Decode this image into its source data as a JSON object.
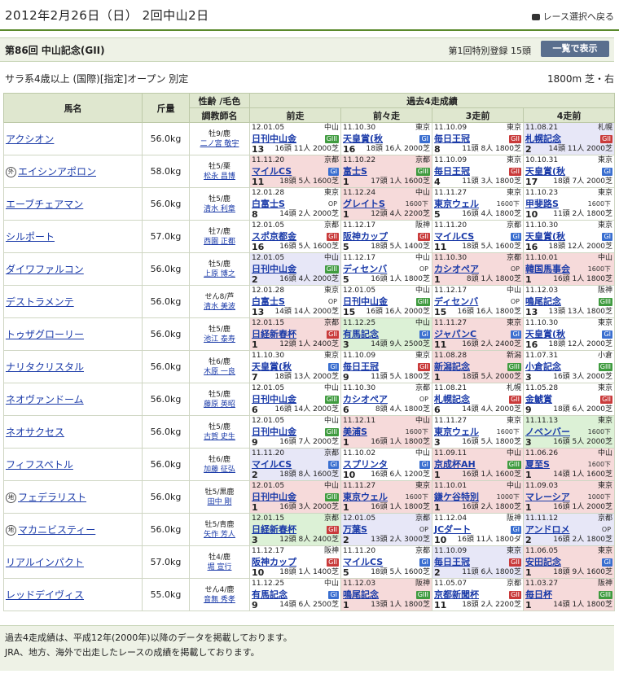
{
  "header": {
    "date": "2012年2月26日（日） 2回中山2日",
    "back_label": "レース選択へ戻る"
  },
  "race": {
    "name": "第86回 中山記念(GII)",
    "registration": "第1回特別登録 15頭",
    "list_button": "一覧で表示",
    "conditions": "サラ系4歳以上 (国際)[指定]オープン 別定",
    "distance": "1800m 芝・右"
  },
  "table_headers": {
    "horse": "馬名",
    "weight": "斤量",
    "sexage_color": "性齢 /毛色",
    "jockey": "調教師名",
    "past4": "過去4走成績",
    "p1": "前走",
    "p2": "前々走",
    "p3": "3走前",
    "p4": "4走前"
  },
  "horses": [
    {
      "name": "アクシオン",
      "tag": "",
      "weight": "56.0kg",
      "sexage": "牡9/鹿",
      "trainer": "二ノ宮 敬宇",
      "races": [
        {
          "date": "12.01.05",
          "venue": "中山",
          "race": "日刊中山金",
          "grade": "GIII",
          "num": "13",
          "pop": "16頭 11人 2000芝",
          "place": "13",
          "bg": ""
        },
        {
          "date": "11.10.30",
          "venue": "東京",
          "race": "天皇賞(秋",
          "grade": "GI",
          "num": "16",
          "pop": "18頭 16人 2000芝",
          "place": "16",
          "bg": ""
        },
        {
          "date": "11.10.09",
          "venue": "東京",
          "race": "毎日王冠",
          "grade": "GII",
          "num": "8",
          "pop": "11頭 8人 1800芝",
          "place": "8",
          "bg": ""
        },
        {
          "date": "11.08.21",
          "venue": "札幌",
          "race": "札幌記念",
          "grade": "GII",
          "num": "2",
          "pop": "14頭 11人 2000芝",
          "place": "2",
          "bg": "bg1"
        }
      ]
    },
    {
      "name": "エイシンアポロン",
      "tag": "外",
      "weight": "58.0kg",
      "sexage": "牡5/栗",
      "trainer": "松永 昌博",
      "races": [
        {
          "date": "11.11.20",
          "venue": "京都",
          "race": "マイルCS",
          "grade": "GI",
          "num": "11",
          "pop": "18頭 5人 1600芝",
          "place": "11",
          "bg": "bg2"
        },
        {
          "date": "11.10.22",
          "venue": "京都",
          "race": "富士S",
          "grade": "GIII",
          "num": "1",
          "pop": "17頭 1人 1600芝",
          "place": "1",
          "bg": "bg2"
        },
        {
          "date": "11.10.09",
          "venue": "東京",
          "race": "毎日王冠",
          "grade": "GII",
          "num": "4",
          "pop": "11頭 3人 1800芝",
          "place": "4",
          "bg": ""
        },
        {
          "date": "10.10.31",
          "venue": "東京",
          "race": "天皇賞(秋",
          "grade": "GI",
          "num": "17",
          "pop": "18頭 7人 2000芝",
          "place": "17",
          "bg": ""
        }
      ]
    },
    {
      "name": "エーブチェアマン",
      "tag": "",
      "weight": "56.0kg",
      "sexage": "牡5/鹿",
      "trainer": "清水 利章",
      "races": [
        {
          "date": "12.01.28",
          "venue": "東京",
          "race": "白富士S",
          "grade": "OP",
          "num": "8",
          "pop": "14頭 2人 2000芝",
          "place": "8",
          "bg": ""
        },
        {
          "date": "11.12.24",
          "venue": "中山",
          "race": "グレイトS",
          "grade": "1600下",
          "num": "1",
          "pop": "12頭 4人 2200芝",
          "place": "1",
          "bg": "bg2"
        },
        {
          "date": "11.11.27",
          "venue": "東京",
          "race": "東京ウェル",
          "grade": "1600下",
          "num": "5",
          "pop": "16頭 4人 1800芝",
          "place": "5",
          "bg": ""
        },
        {
          "date": "11.10.23",
          "venue": "東京",
          "race": "甲斐路S",
          "grade": "1600下",
          "num": "10",
          "pop": "11頭 2人 1800芝",
          "place": "10",
          "bg": ""
        }
      ]
    },
    {
      "name": "シルポート",
      "tag": "",
      "weight": "57.0kg",
      "sexage": "牡7/鹿",
      "trainer": "西園 正都",
      "races": [
        {
          "date": "12.01.05",
          "venue": "京都",
          "race": "スポ京都金",
          "grade": "GII",
          "num": "16",
          "pop": "16頭 5人 1600芝",
          "place": "16",
          "bg": ""
        },
        {
          "date": "11.12.17",
          "venue": "阪神",
          "race": "阪神カップ",
          "grade": "GII",
          "num": "5",
          "pop": "18頭 5人 1400芝",
          "place": "5",
          "bg": ""
        },
        {
          "date": "11.11.20",
          "venue": "京都",
          "race": "マイルCS",
          "grade": "GI",
          "num": "11",
          "pop": "18頭 5人 1600芝",
          "place": "11",
          "bg": ""
        },
        {
          "date": "11.10.30",
          "venue": "東京",
          "race": "天皇賞(秋",
          "grade": "GI",
          "num": "16",
          "pop": "18頭 12人 2000芝",
          "place": "16",
          "bg": ""
        }
      ]
    },
    {
      "name": "ダイワファルコン",
      "tag": "",
      "weight": "56.0kg",
      "sexage": "牡5/鹿",
      "trainer": "上原 博之",
      "races": [
        {
          "date": "12.01.05",
          "venue": "中山",
          "race": "日刊中山金",
          "grade": "GIII",
          "num": "2",
          "pop": "16頭 4人 2000芝",
          "place": "2",
          "bg": "bg1"
        },
        {
          "date": "11.12.17",
          "venue": "中山",
          "race": "ディセンバ",
          "grade": "OP",
          "num": "5",
          "pop": "16頭 1人 1800芝",
          "place": "5",
          "bg": ""
        },
        {
          "date": "11.10.30",
          "venue": "京都",
          "race": "カシオペア",
          "grade": "OP",
          "num": "1",
          "pop": "8頭 1人 1800芝",
          "place": "1",
          "bg": "bg2"
        },
        {
          "date": "11.10.01",
          "venue": "中山",
          "race": "韓国馬事会",
          "grade": "1600下",
          "num": "1",
          "pop": "16頭 1人 1800芝",
          "place": "1",
          "bg": "bg2"
        }
      ]
    },
    {
      "name": "デストラメンテ",
      "tag": "",
      "weight": "56.0kg",
      "sexage": "せん8/芦",
      "trainer": "清水 美波",
      "races": [
        {
          "date": "12.01.28",
          "venue": "東京",
          "race": "白富士S",
          "grade": "OP",
          "num": "13",
          "pop": "14頭 14人 2000芝",
          "place": "13",
          "bg": ""
        },
        {
          "date": "12.01.05",
          "venue": "中山",
          "race": "日刊中山金",
          "grade": "GIII",
          "num": "15",
          "pop": "16頭 16人 2000芝",
          "place": "15",
          "bg": ""
        },
        {
          "date": "11.12.17",
          "venue": "中山",
          "race": "ディセンバ",
          "grade": "OP",
          "num": "15",
          "pop": "16頭 16人 1800芝",
          "place": "15",
          "bg": ""
        },
        {
          "date": "11.12.03",
          "venue": "阪神",
          "race": "鳴尾記念",
          "grade": "GIII",
          "num": "13",
          "pop": "13頭 13人 1800芝",
          "place": "13",
          "bg": ""
        }
      ]
    },
    {
      "name": "トゥザグローリー",
      "tag": "",
      "weight": "56.0kg",
      "sexage": "牡5/鹿",
      "trainer": "池江 泰寿",
      "races": [
        {
          "date": "12.01.15",
          "venue": "京都",
          "race": "日経新春杯",
          "grade": "GII",
          "num": "1",
          "pop": "12頭 1人 2400芝",
          "place": "1",
          "bg": "bg2"
        },
        {
          "date": "11.12.25",
          "venue": "中山",
          "race": "有馬記念",
          "grade": "GI",
          "num": "3",
          "pop": "14頭 9人 2500芝",
          "place": "3",
          "bg": "bg3"
        },
        {
          "date": "11.11.27",
          "venue": "東京",
          "race": "ジャパンC",
          "grade": "GI",
          "num": "11",
          "pop": "16頭 2人 2400芝",
          "place": "11",
          "bg": "bg2"
        },
        {
          "date": "11.10.30",
          "venue": "東京",
          "race": "天皇賞(秋",
          "grade": "GI",
          "num": "16",
          "pop": "18頭 12人 2000芝",
          "place": "16",
          "bg": ""
        }
      ]
    },
    {
      "name": "ナリタクリスタル",
      "tag": "",
      "weight": "56.0kg",
      "sexage": "牡6/鹿",
      "trainer": "木原 一良",
      "races": [
        {
          "date": "11.10.30",
          "venue": "東京",
          "race": "天皇賞(秋",
          "grade": "GI",
          "num": "7",
          "pop": "18頭 13人 2000芝",
          "place": "7",
          "bg": ""
        },
        {
          "date": "11.10.09",
          "venue": "東京",
          "race": "毎日王冠",
          "grade": "GII",
          "num": "9",
          "pop": "11頭 5人 1800芝",
          "place": "9",
          "bg": ""
        },
        {
          "date": "11.08.28",
          "venue": "新潟",
          "race": "新潟記念",
          "grade": "GIII",
          "num": "1",
          "pop": "18頭 5人 2000芝",
          "place": "1",
          "bg": "bg2"
        },
        {
          "date": "11.07.31",
          "venue": "小倉",
          "race": "小倉記念",
          "grade": "GIII",
          "num": "3",
          "pop": "16頭 3人 2000芝",
          "place": "3",
          "bg": ""
        }
      ]
    },
    {
      "name": "ネオヴァンドーム",
      "tag": "",
      "weight": "56.0kg",
      "sexage": "牡5/鹿",
      "trainer": "藤原 英昭",
      "races": [
        {
          "date": "12.01.05",
          "venue": "中山",
          "race": "日刊中山金",
          "grade": "GIII",
          "num": "6",
          "pop": "16頭 14人 2000芝",
          "place": "6",
          "bg": ""
        },
        {
          "date": "11.10.30",
          "venue": "京都",
          "race": "カシオペア",
          "grade": "OP",
          "num": "6",
          "pop": "8頭 4人 1800芝",
          "place": "6",
          "bg": ""
        },
        {
          "date": "11.08.21",
          "venue": "札幌",
          "race": "札幌記念",
          "grade": "GII",
          "num": "6",
          "pop": "14頭 4人 2000芝",
          "place": "6",
          "bg": ""
        },
        {
          "date": "11.05.28",
          "venue": "東京",
          "race": "金鯱賞",
          "grade": "GII",
          "num": "9",
          "pop": "18頭 6人 2000芝",
          "place": "9",
          "bg": ""
        }
      ]
    },
    {
      "name": "ネオサクセス",
      "tag": "",
      "weight": "56.0kg",
      "sexage": "牡5/鹿",
      "trainer": "古賀 史生",
      "races": [
        {
          "date": "12.01.05",
          "venue": "中山",
          "race": "日刊中山金",
          "grade": "GIII",
          "num": "9",
          "pop": "16頭 7人 2000芝",
          "place": "9",
          "bg": ""
        },
        {
          "date": "11.12.11",
          "venue": "中山",
          "race": "美浦S",
          "grade": "1600下",
          "num": "1",
          "pop": "16頭 1人 1800芝",
          "place": "1",
          "bg": "bg2"
        },
        {
          "date": "11.11.27",
          "venue": "東京",
          "race": "東京ウェル",
          "grade": "1600下",
          "num": "3",
          "pop": "16頭 5人 1800芝",
          "place": "3",
          "bg": ""
        },
        {
          "date": "11.11.13",
          "venue": "東京",
          "race": "ノベンバー",
          "grade": "1600下",
          "num": "3",
          "pop": "16頭 5人 2000芝",
          "place": "3",
          "bg": "bg3"
        }
      ]
    },
    {
      "name": "フィフスペトル",
      "tag": "",
      "weight": "56.0kg",
      "sexage": "牡6/鹿",
      "trainer": "加藤 征弘",
      "races": [
        {
          "date": "11.11.20",
          "venue": "京都",
          "race": "マイルCS",
          "grade": "GI",
          "num": "2",
          "pop": "18頭 8人 1600芝",
          "place": "2",
          "bg": "bg1"
        },
        {
          "date": "11.10.02",
          "venue": "中山",
          "race": "スプリンタ",
          "grade": "GI",
          "num": "10",
          "pop": "16頭 6人 1200芝",
          "place": "10",
          "bg": ""
        },
        {
          "date": "11.09.11",
          "venue": "中山",
          "race": "京成杯AH",
          "grade": "GIII",
          "num": "1",
          "pop": "16頭 1人 1600芝",
          "place": "1",
          "bg": "bg2"
        },
        {
          "date": "11.06.26",
          "venue": "中山",
          "race": "夏至S",
          "grade": "1600下",
          "num": "1",
          "pop": "14頭 1人 1600芝",
          "place": "1",
          "bg": "bg2"
        }
      ]
    },
    {
      "name": "フェデラリスト",
      "tag": "地",
      "weight": "56.0kg",
      "sexage": "牡5/黒鹿",
      "trainer": "田中 剛",
      "races": [
        {
          "date": "12.01.05",
          "venue": "中山",
          "race": "日刊中山金",
          "grade": "GIII",
          "num": "1",
          "pop": "16頭 3人 2000芝",
          "place": "1",
          "bg": "bg2"
        },
        {
          "date": "11.11.27",
          "venue": "東京",
          "race": "東京ウェル",
          "grade": "1600下",
          "num": "1",
          "pop": "16頭 1人 1800芝",
          "place": "1",
          "bg": "bg2"
        },
        {
          "date": "11.10.01",
          "venue": "中山",
          "race": "鎌ケ谷特別",
          "grade": "1000下",
          "num": "1",
          "pop": "16頭 2人 1800芝",
          "place": "1",
          "bg": "bg2"
        },
        {
          "date": "11.09.03",
          "venue": "東京",
          "race": "マレーシア",
          "grade": "1000下",
          "num": "1",
          "pop": "16頭 1人 2000芝",
          "place": "1",
          "bg": "bg2"
        }
      ]
    },
    {
      "name": "マカニビスティー",
      "tag": "地",
      "weight": "56.0kg",
      "sexage": "牡5/青鹿",
      "trainer": "矢作 芳人",
      "races": [
        {
          "date": "12.01.15",
          "venue": "京都",
          "race": "日経新春杯",
          "grade": "GII",
          "num": "3",
          "pop": "12頭 8人 2400芝",
          "place": "3",
          "bg": "bg3"
        },
        {
          "date": "12.01.05",
          "venue": "京都",
          "race": "万葉S",
          "grade": "OP",
          "num": "2",
          "pop": "13頭 2人 3000芝",
          "place": "2",
          "bg": "bg1"
        },
        {
          "date": "11.12.04",
          "venue": "阪神",
          "race": "JCダート",
          "grade": "GI",
          "num": "10",
          "pop": "16頭 11人 1800ダ",
          "place": "10",
          "bg": ""
        },
        {
          "date": "11.11.12",
          "venue": "京都",
          "race": "アンドロメ",
          "grade": "OP",
          "num": "2",
          "pop": "16頭 2人 1800芝",
          "place": "2",
          "bg": "bg1"
        }
      ]
    },
    {
      "name": "リアルインパクト",
      "tag": "",
      "weight": "57.0kg",
      "sexage": "牡4/鹿",
      "trainer": "堀 宣行",
      "races": [
        {
          "date": "11.12.17",
          "venue": "阪神",
          "race": "阪神カップ",
          "grade": "GII",
          "num": "10",
          "pop": "18頭 1人 1400芝",
          "place": "10",
          "bg": ""
        },
        {
          "date": "11.11.20",
          "venue": "京都",
          "race": "マイルCS",
          "grade": "GI",
          "num": "5",
          "pop": "18頭 5人 1600芝",
          "place": "5",
          "bg": ""
        },
        {
          "date": "11.10.09",
          "venue": "東京",
          "race": "毎日王冠",
          "grade": "GII",
          "num": "2",
          "pop": "11頭 6人 1800芝",
          "place": "2",
          "bg": "bg1"
        },
        {
          "date": "11.06.05",
          "venue": "東京",
          "race": "安田記念",
          "grade": "GI",
          "num": "1",
          "pop": "18頭 9人 1600芝",
          "place": "1",
          "bg": "bg2"
        }
      ]
    },
    {
      "name": "レッドデイヴィス",
      "tag": "",
      "weight": "55.0kg",
      "sexage": "せん4/鹿",
      "trainer": "音無 秀孝",
      "races": [
        {
          "date": "11.12.25",
          "venue": "中山",
          "race": "有馬記念",
          "grade": "GI",
          "num": "9",
          "pop": "14頭 6人 2500芝",
          "place": "9",
          "bg": ""
        },
        {
          "date": "11.12.03",
          "venue": "阪神",
          "race": "鳴尾記念",
          "grade": "GIII",
          "num": "1",
          "pop": "13頭 1人 1800芝",
          "place": "1",
          "bg": "bg2"
        },
        {
          "date": "11.05.07",
          "venue": "京都",
          "race": "京都新聞杯",
          "grade": "GII",
          "num": "11",
          "pop": "18頭 2人 2200芝",
          "place": "11",
          "bg": ""
        },
        {
          "date": "11.03.27",
          "venue": "阪神",
          "race": "毎日杯",
          "grade": "GIII",
          "num": "1",
          "pop": "14頭 1人 1800芝",
          "place": "1",
          "bg": "bg2"
        }
      ]
    }
  ],
  "footnote": {
    "line1": "過去4走成績は、平成12年(2000年)以降のデータを掲載しております。",
    "line2": "JRA、地方、海外で出走したレースの成績を掲載しております。"
  }
}
